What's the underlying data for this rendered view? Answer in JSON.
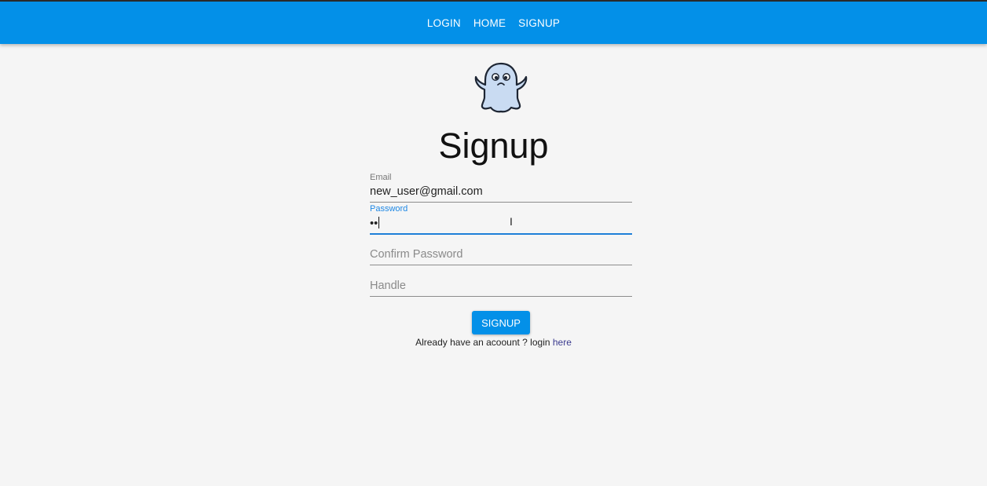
{
  "nav": {
    "items": [
      {
        "label": "LOGIN"
      },
      {
        "label": "HOME"
      },
      {
        "label": "SIGNUP"
      }
    ]
  },
  "page": {
    "title": "Signup",
    "logo_icon": "ghost-icon"
  },
  "form": {
    "email": {
      "label": "Email",
      "value": "new_user@gmail.com"
    },
    "password": {
      "label": "Password",
      "value": "••"
    },
    "confirm_password": {
      "placeholder": "Confirm Password"
    },
    "handle": {
      "placeholder": "Handle"
    },
    "submit_label": "SIGNUP"
  },
  "footer": {
    "text": "Already have an acoount ? login ",
    "link": "here"
  },
  "colors": {
    "appbar": "#0390e8",
    "focus": "#1e7fd8"
  }
}
